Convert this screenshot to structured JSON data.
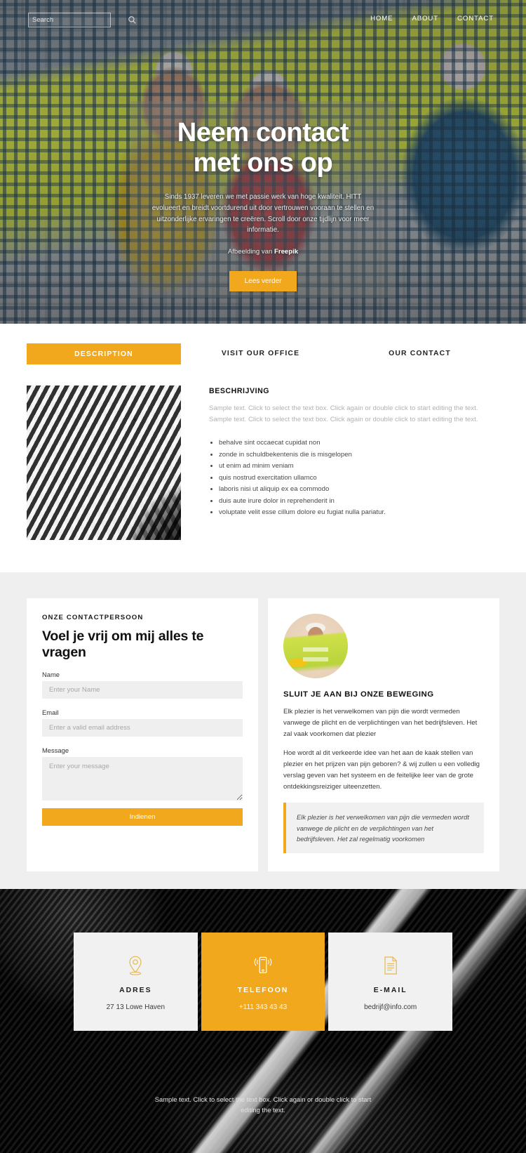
{
  "theme": {
    "accent": "#F2A81C",
    "dark": "#040404",
    "gray": "#efefef"
  },
  "header": {
    "search": {
      "placeholder": "Search",
      "value": "",
      "icon": "search-icon"
    },
    "nav": [
      {
        "label": "HOME"
      },
      {
        "label": "ABOUT"
      },
      {
        "label": "CONTACT"
      }
    ]
  },
  "hero": {
    "title_line1": "Neem contact",
    "title_line2": "met ons op",
    "subtitle": "Sinds 1937 leveren we met passie werk van hoge kwaliteit. HITT evolueert en breidt voortdurend uit door vertrouwen vooraan te stellen en uitzonderlijke ervaringen te creëren. Scroll door onze tijdlijn voor meer informatie.",
    "credit_prefix": "Afbeelding van ",
    "credit_source": "Freepik",
    "cta_label": "Lees verder"
  },
  "tabs": {
    "items": [
      {
        "label": "DESCRIPTION",
        "active": true
      },
      {
        "label": "VISIT OUR OFFICE",
        "active": false
      },
      {
        "label": "OUR CONTACT",
        "active": false
      }
    ],
    "panel": {
      "heading": "BESCHRIJVING",
      "paragraph": "Sample text. Click to select the text box. Click again or double click to start editing the text. Sample text. Click to select the text box. Click again or double click to start editing the text.",
      "bullets": [
        "behalve sint occaecat cupidat non",
        "zonde in schuldbekentenis die is misgelopen",
        "ut enim ad minim veniam",
        "quis nostrud exercitation ullamco",
        "laboris nisi ut aliquip ex ea commodo",
        "duis aute irure dolor in reprehenderit in",
        "voluptate velit esse cillum dolore eu fugiat nulla pariatur."
      ]
    }
  },
  "contact_form": {
    "eyebrow": "ONZE CONTACTPERSOON",
    "title": "Voel je vrij om mij alles te vragen",
    "fields": [
      {
        "label": "Name",
        "placeholder": "Enter your Name",
        "value": "",
        "type": "text"
      },
      {
        "label": "Email",
        "placeholder": "Enter a valid email address",
        "value": "",
        "type": "text"
      },
      {
        "label": "Message",
        "placeholder": "Enter your message",
        "value": "",
        "type": "textarea"
      }
    ],
    "submit_label": "Indienen"
  },
  "movement": {
    "avatar_alt": "construction-worker-photo",
    "title": "SLUIT JE AAN BIJ ONZE BEWEGING",
    "paragraph1": "Elk plezier is het verwelkomen van pijn die wordt vermeden vanwege de plicht en de verplichtingen van het bedrijfsleven. Het zal vaak voorkomen dat plezier",
    "paragraph2": "Hoe wordt al dit verkeerde idee van het aan de kaak stellen van plezier en het prijzen van pijn geboren? & wij zullen u een volledig verslag geven van het systeem en de feitelijke leer van de grote ontdekkingsreiziger uiteenzetten.",
    "quote": "Elk plezier is het verwelkomen van pijn die vermeden wordt vanwege de plicht en de verplichtingen van het bedrijfsleven. Het zal regelmatig voorkomen"
  },
  "info_cards": [
    {
      "icon": "map-pin-icon",
      "label": "ADRES",
      "value": "27 13 Lowe Haven",
      "accent": false
    },
    {
      "icon": "mobile-phone-icon",
      "label": "TELEFOON",
      "value": "+111 343 43 43",
      "accent": true
    },
    {
      "icon": "document-icon",
      "label": "E-MAIL",
      "value": "bedrijf@info.com",
      "accent": false
    }
  ],
  "footer": {
    "note": "Sample text. Click to select the text box. Click again or double click to start editing the text."
  }
}
